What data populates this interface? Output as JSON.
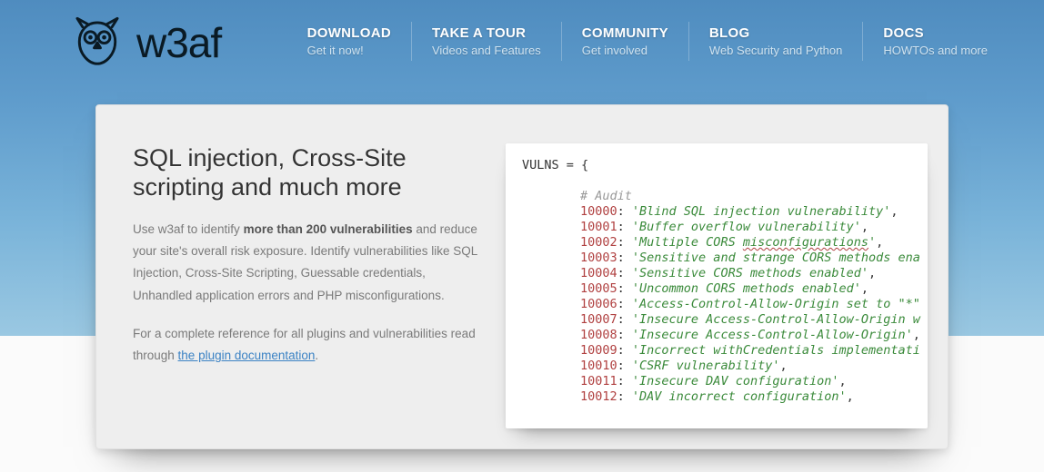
{
  "brand": {
    "name": "w3af"
  },
  "nav": [
    {
      "title": "DOWNLOAD",
      "sub": "Get it now!"
    },
    {
      "title": "TAKE A TOUR",
      "sub": "Videos and Features"
    },
    {
      "title": "COMMUNITY",
      "sub": "Get involved"
    },
    {
      "title": "BLOG",
      "sub": "Web Security and Python"
    },
    {
      "title": "DOCS",
      "sub": "HOWTOs and more"
    }
  ],
  "hero": {
    "title": "SQL injection, Cross-Site scripting and much more",
    "p1_a": "Use w3af to identify ",
    "p1_b": "more than 200 vulnerabilities",
    "p1_c": " and reduce your site's overall risk exposure. Identify vulnerabilities like SQL Injection, Cross-Site Scripting, Guessable credentials, Unhandled application errors and PHP misconfigurations.",
    "p2_a": "For a complete reference for all plugins and vulnerabilities read through ",
    "p2_link": "the plugin documentation",
    "p2_b": "."
  },
  "code": {
    "head": "VULNS = {",
    "comment": "# Audit",
    "entries": [
      {
        "k": "10000",
        "v": "'Blind SQL injection vulnerability'",
        "tail": ","
      },
      {
        "k": "10001",
        "v": "'Buffer overflow vulnerability'",
        "tail": ","
      },
      {
        "k": "10002",
        "v": "'Multiple CORS misconfigurations'",
        "tail": ",",
        "wavy": "misconfigurations"
      },
      {
        "k": "10003",
        "v": "'Sensitive and strange CORS methods ena",
        "tail": ""
      },
      {
        "k": "10004",
        "v": "'Sensitive CORS methods enabled'",
        "tail": ","
      },
      {
        "k": "10005",
        "v": "'Uncommon CORS methods enabled'",
        "tail": ","
      },
      {
        "k": "10006",
        "v": "'Access-Control-Allow-Origin set to \"*\"",
        "tail": ""
      },
      {
        "k": "10007",
        "v": "'Insecure Access-Control-Allow-Origin w",
        "tail": ""
      },
      {
        "k": "10008",
        "v": "'Insecure Access-Control-Allow-Origin'",
        "tail": ","
      },
      {
        "k": "10009",
        "v": "'Incorrect withCredentials implementati",
        "tail": ""
      },
      {
        "k": "10010",
        "v": "'CSRF vulnerability'",
        "tail": ","
      },
      {
        "k": "10011",
        "v": "'Insecure DAV configuration'",
        "tail": ","
      },
      {
        "k": "10012",
        "v": "'DAV incorrect configuration'",
        "tail": ","
      }
    ]
  }
}
